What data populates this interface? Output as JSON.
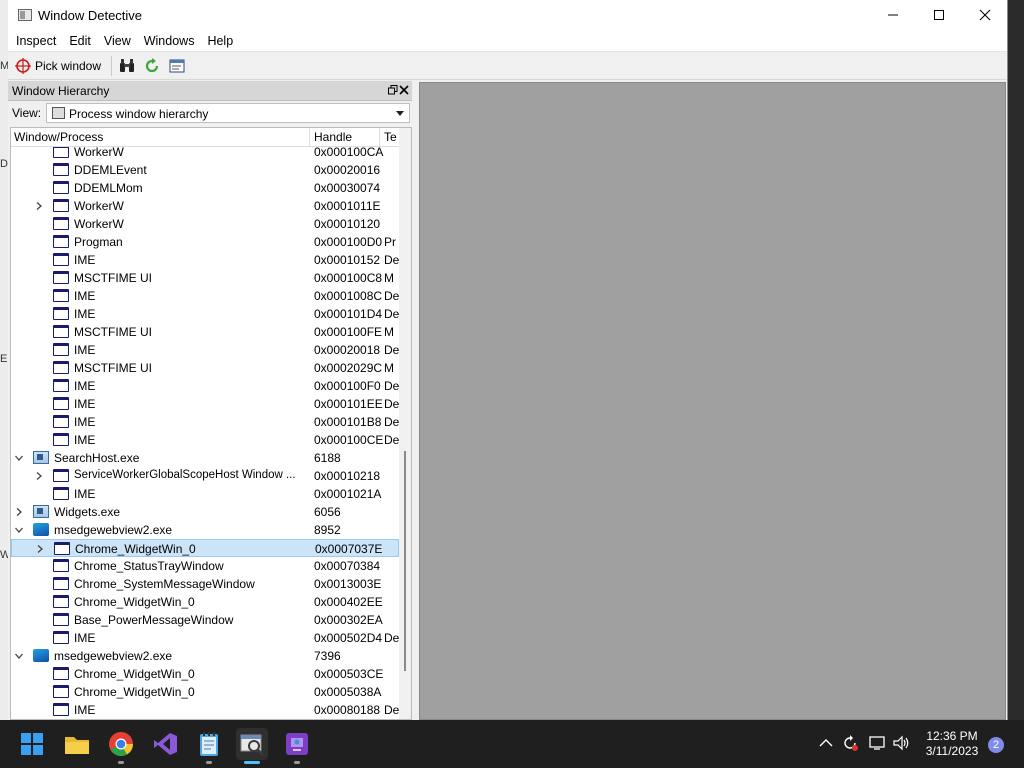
{
  "window": {
    "title": "Window Detective",
    "controls": [
      "minimize",
      "maximize",
      "close"
    ]
  },
  "menu": {
    "items": [
      "Inspect",
      "Edit",
      "View",
      "Windows",
      "Help"
    ]
  },
  "toolbar": {
    "pick_window_label": "Pick window",
    "buttons": [
      "crosshair-icon",
      "binoculars-icon",
      "refresh-icon",
      "properties-icon"
    ]
  },
  "hierarchy_panel": {
    "title": "Window Hierarchy",
    "view_label": "View:",
    "view_selected": "Process window hierarchy",
    "columns": [
      "Window/Process",
      "Handle",
      "Te"
    ],
    "rows": [
      {
        "indent": 2,
        "type": "window",
        "expand": "",
        "name": "WorkerW",
        "handle": "0x000100CA",
        "text": ""
      },
      {
        "indent": 2,
        "type": "window",
        "expand": "",
        "name": "DDEMLEvent",
        "handle": "0x00020016",
        "text": ""
      },
      {
        "indent": 2,
        "type": "window",
        "expand": "",
        "name": "DDEMLMom",
        "handle": "0x00030074",
        "text": ""
      },
      {
        "indent": 2,
        "type": "window",
        "expand": "collapsed",
        "name": "WorkerW",
        "handle": "0x0001011E",
        "text": ""
      },
      {
        "indent": 2,
        "type": "window",
        "expand": "",
        "name": "WorkerW",
        "handle": "0x00010120",
        "text": ""
      },
      {
        "indent": 2,
        "type": "window",
        "expand": "",
        "name": "Progman",
        "handle": "0x000100D0",
        "text": "Pr"
      },
      {
        "indent": 2,
        "type": "window",
        "expand": "",
        "name": "IME",
        "handle": "0x00010152",
        "text": "De"
      },
      {
        "indent": 2,
        "type": "window",
        "expand": "",
        "name": "MSCTFIME UI",
        "handle": "0x000100C8",
        "text": "M"
      },
      {
        "indent": 2,
        "type": "window",
        "expand": "",
        "name": "IME",
        "handle": "0x0001008C",
        "text": "De"
      },
      {
        "indent": 2,
        "type": "window",
        "expand": "",
        "name": "IME",
        "handle": "0x000101D4",
        "text": "De"
      },
      {
        "indent": 2,
        "type": "window",
        "expand": "",
        "name": "MSCTFIME UI",
        "handle": "0x000100FE",
        "text": "M"
      },
      {
        "indent": 2,
        "type": "window",
        "expand": "",
        "name": "IME",
        "handle": "0x00020018",
        "text": "De"
      },
      {
        "indent": 2,
        "type": "window",
        "expand": "",
        "name": "MSCTFIME UI",
        "handle": "0x0002029C",
        "text": "M"
      },
      {
        "indent": 2,
        "type": "window",
        "expand": "",
        "name": "IME",
        "handle": "0x000100F0",
        "text": "De"
      },
      {
        "indent": 2,
        "type": "window",
        "expand": "",
        "name": "IME",
        "handle": "0x000101EE",
        "text": "De"
      },
      {
        "indent": 2,
        "type": "window",
        "expand": "",
        "name": "IME",
        "handle": "0x000101B8",
        "text": "De"
      },
      {
        "indent": 2,
        "type": "window",
        "expand": "",
        "name": "IME",
        "handle": "0x000100CE",
        "text": "De"
      },
      {
        "indent": 1,
        "type": "process",
        "expand": "expanded",
        "name": "SearchHost.exe",
        "handle": "6188",
        "text": ""
      },
      {
        "indent": 2,
        "type": "window",
        "expand": "collapsed",
        "name": "ServiceWorkerGlobalScopeHost Window ...",
        "handle": "0x00010218",
        "text": ""
      },
      {
        "indent": 2,
        "type": "window",
        "expand": "",
        "name": "IME",
        "handle": "0x0001021A",
        "text": ""
      },
      {
        "indent": 1,
        "type": "process",
        "expand": "collapsed",
        "name": "Widgets.exe",
        "handle": "6056",
        "text": ""
      },
      {
        "indent": 1,
        "type": "edge",
        "expand": "expanded",
        "name": "msedgewebview2.exe",
        "handle": "8952",
        "text": ""
      },
      {
        "indent": 2,
        "type": "window",
        "expand": "collapsed",
        "name": "Chrome_WidgetWin_0",
        "handle": "0x0007037E",
        "text": "",
        "selected": true
      },
      {
        "indent": 2,
        "type": "window",
        "expand": "",
        "name": "Chrome_StatusTrayWindow",
        "handle": "0x00070384",
        "text": ""
      },
      {
        "indent": 2,
        "type": "window",
        "expand": "",
        "name": "Chrome_SystemMessageWindow",
        "handle": "0x0013003E",
        "text": ""
      },
      {
        "indent": 2,
        "type": "window",
        "expand": "",
        "name": "Chrome_WidgetWin_0",
        "handle": "0x000402EE",
        "text": ""
      },
      {
        "indent": 2,
        "type": "window",
        "expand": "",
        "name": "Base_PowerMessageWindow",
        "handle": "0x000302EA",
        "text": ""
      },
      {
        "indent": 2,
        "type": "window",
        "expand": "",
        "name": "IME",
        "handle": "0x000502D4",
        "text": "De"
      },
      {
        "indent": 1,
        "type": "edge",
        "expand": "expanded",
        "name": "msedgewebview2.exe",
        "handle": "7396",
        "text": ""
      },
      {
        "indent": 2,
        "type": "window",
        "expand": "",
        "name": "Chrome_WidgetWin_0",
        "handle": "0x000503CE",
        "text": ""
      },
      {
        "indent": 2,
        "type": "window",
        "expand": "",
        "name": "Chrome_WidgetWin_0",
        "handle": "0x0005038A",
        "text": ""
      },
      {
        "indent": 2,
        "type": "window",
        "expand": "",
        "name": "IME",
        "handle": "0x00080188",
        "text": "De"
      }
    ]
  },
  "taskbar": {
    "apps": [
      "start-icon",
      "file-explorer-icon",
      "chrome-icon",
      "visual-studio-icon",
      "notepad-icon",
      "window-detective-icon",
      "app-icon"
    ],
    "active_app": "window-detective-icon",
    "time": "12:36 PM",
    "date": "3/11/2023",
    "notification_count": "2"
  },
  "desktop": {
    "edge_letters": [
      "M",
      "D",
      "E",
      "W"
    ]
  }
}
